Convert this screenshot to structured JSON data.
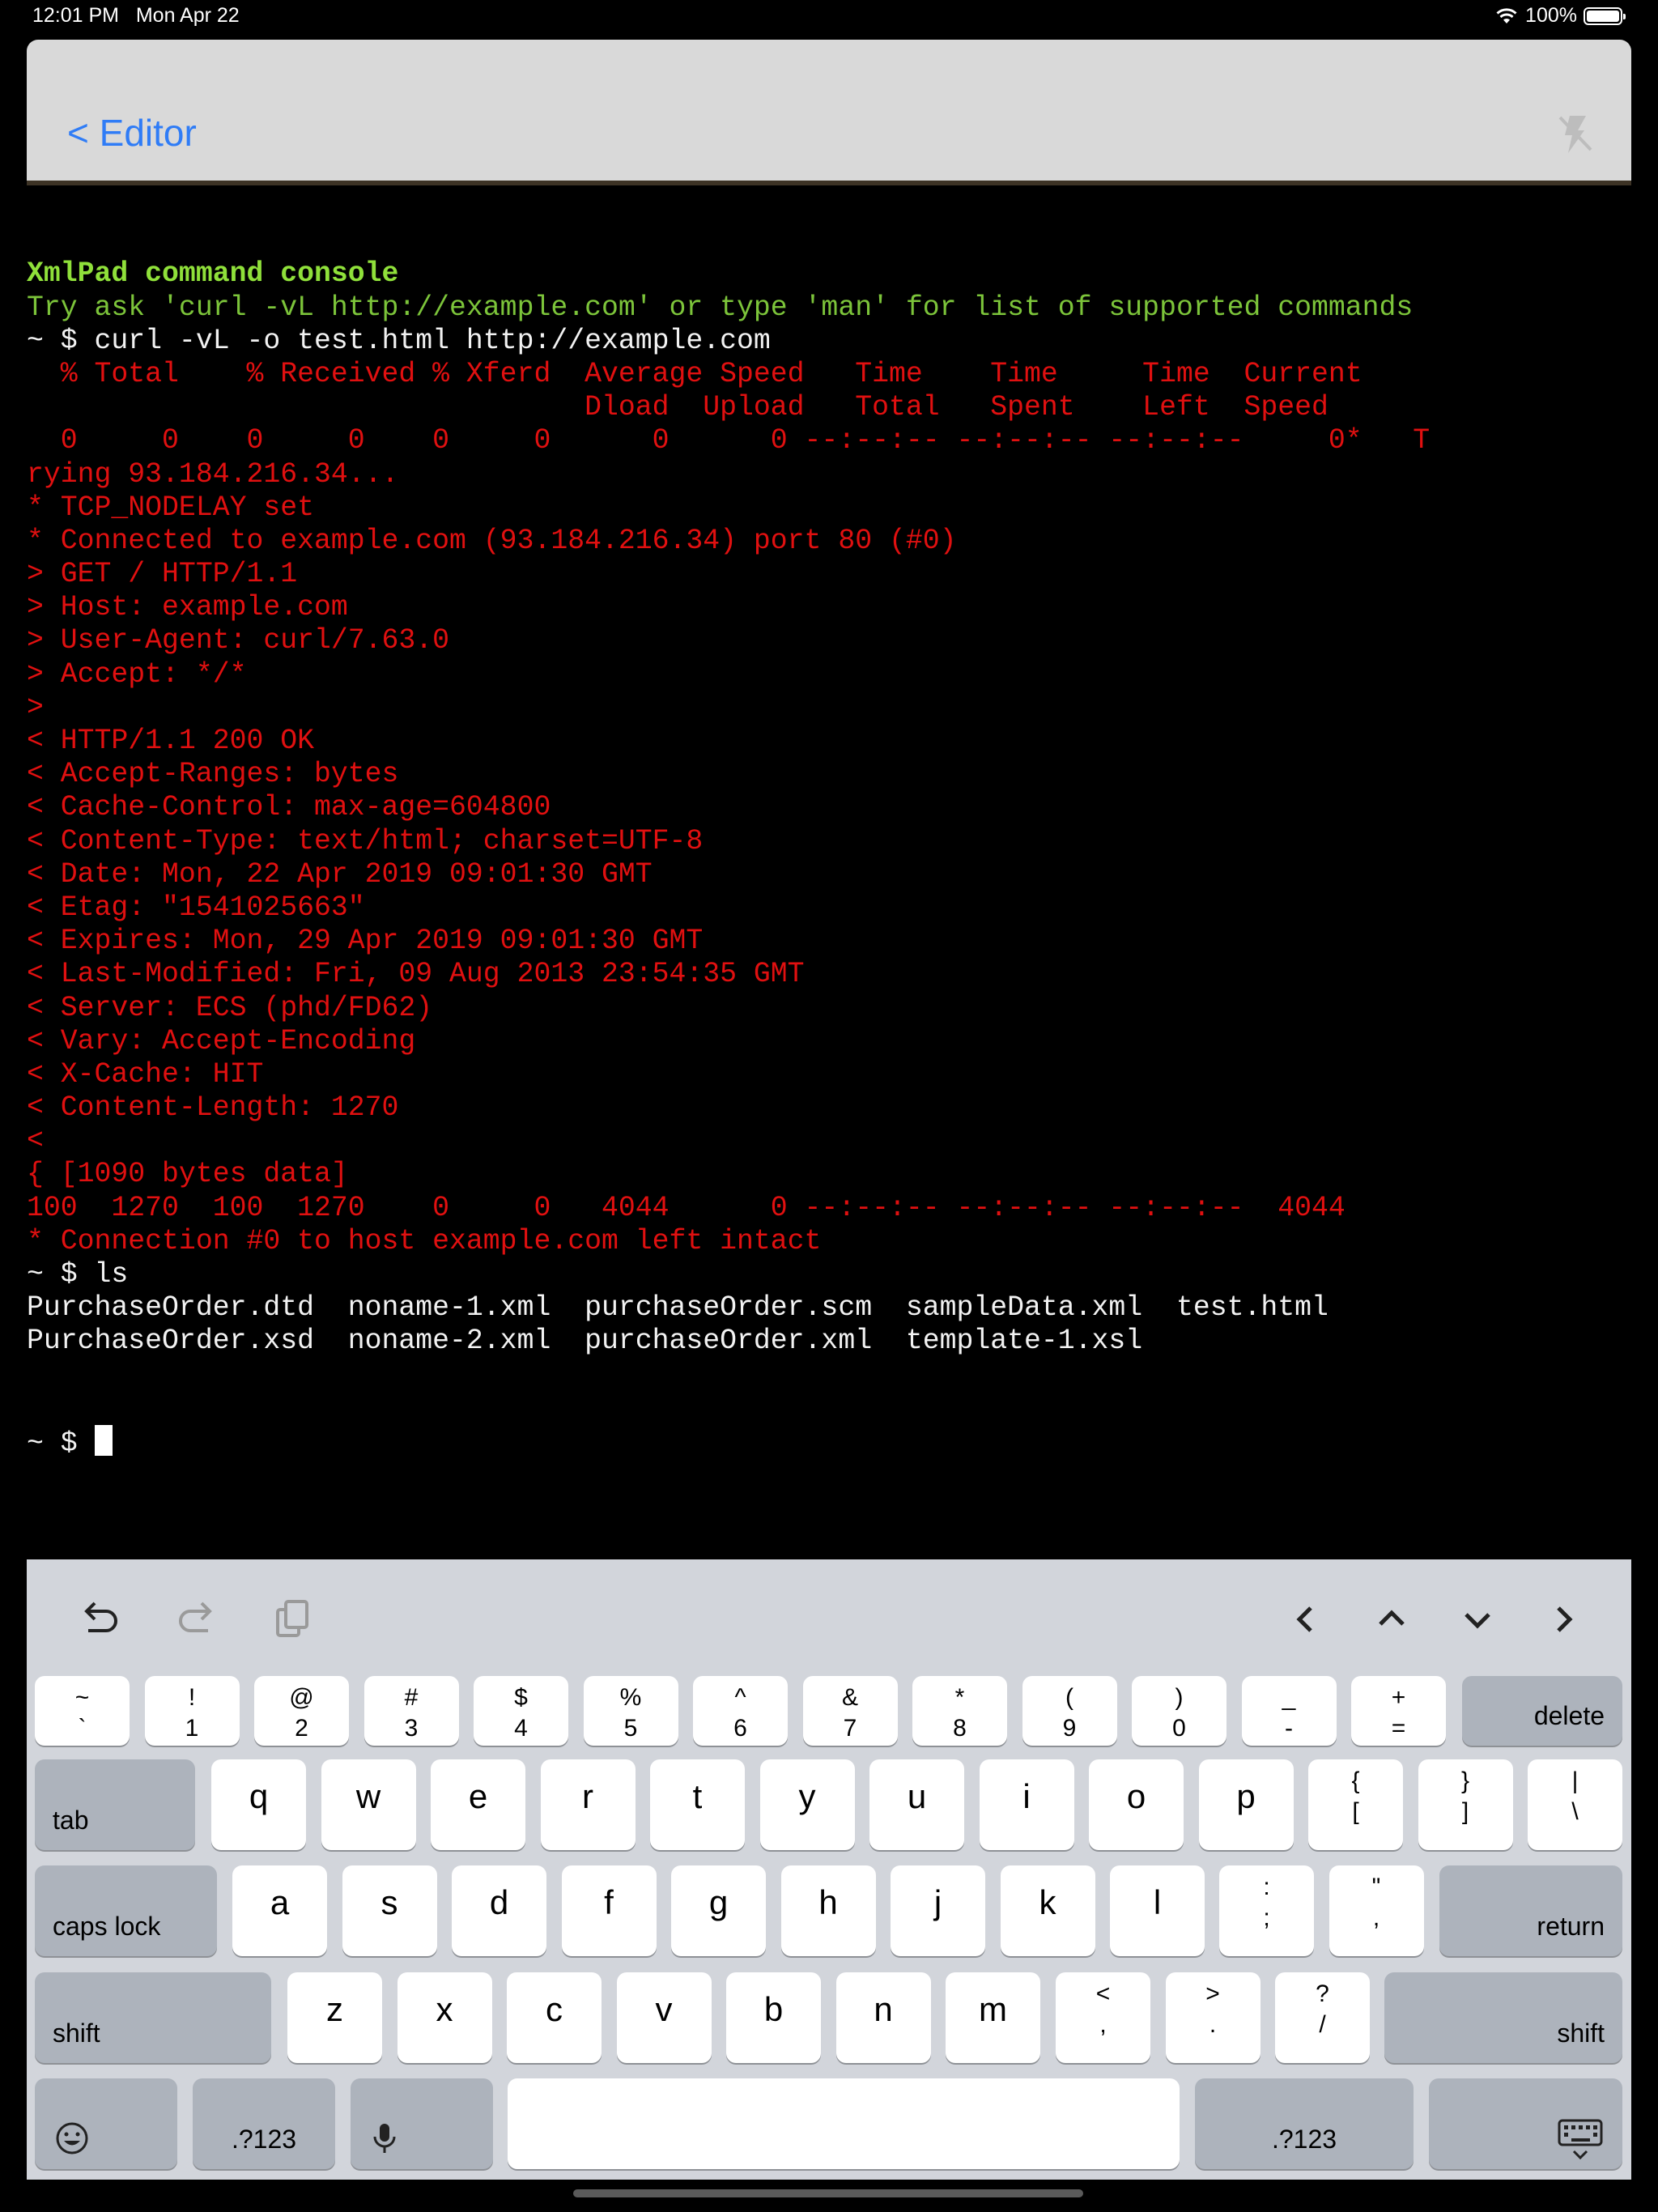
{
  "status_bar": {
    "time": "12:01 PM",
    "date": "Mon Apr 22",
    "battery": "100%",
    "battery_level": 1.0
  },
  "nav": {
    "back_label": "< Editor",
    "flash_icon": "flash-off-icon"
  },
  "terminal": {
    "lines": [
      {
        "text": "XmlPad command console",
        "kind": "title"
      },
      {
        "text": "Try ask 'curl -vL http://example.com' or type 'man' for list of supported commands",
        "kind": "hint"
      },
      {
        "text": "~ $ curl -vL -o test.html http://example.com",
        "kind": "cmd"
      },
      {
        "text": "  % Total    % Received % Xferd  Average Speed   Time    Time     Time  Current",
        "kind": "err"
      },
      {
        "text": "                                 Dload  Upload   Total   Spent    Left  Speed",
        "kind": "err"
      },
      {
        "text": "  0     0    0     0    0     0      0      0 --:--:-- --:--:-- --:--:--     0*   T",
        "kind": "err"
      },
      {
        "text": "rying 93.184.216.34...",
        "kind": "err"
      },
      {
        "text": "* TCP_NODELAY set",
        "kind": "err"
      },
      {
        "text": "* Connected to example.com (93.184.216.34) port 80 (#0)",
        "kind": "err"
      },
      {
        "text": "> GET / HTTP/1.1",
        "kind": "err"
      },
      {
        "text": "> Host: example.com",
        "kind": "err"
      },
      {
        "text": "> User-Agent: curl/7.63.0",
        "kind": "err"
      },
      {
        "text": "> Accept: */*",
        "kind": "err"
      },
      {
        "text": ">",
        "kind": "err"
      },
      {
        "text": "< HTTP/1.1 200 OK",
        "kind": "err"
      },
      {
        "text": "< Accept-Ranges: bytes",
        "kind": "err"
      },
      {
        "text": "< Cache-Control: max-age=604800",
        "kind": "err"
      },
      {
        "text": "< Content-Type: text/html; charset=UTF-8",
        "kind": "err"
      },
      {
        "text": "< Date: Mon, 22 Apr 2019 09:01:30 GMT",
        "kind": "err"
      },
      {
        "text": "< Etag: \"1541025663\"",
        "kind": "err"
      },
      {
        "text": "< Expires: Mon, 29 Apr 2019 09:01:30 GMT",
        "kind": "err"
      },
      {
        "text": "< Last-Modified: Fri, 09 Aug 2013 23:54:35 GMT",
        "kind": "err"
      },
      {
        "text": "< Server: ECS (phd/FD62)",
        "kind": "err"
      },
      {
        "text": "< Vary: Accept-Encoding",
        "kind": "err"
      },
      {
        "text": "< X-Cache: HIT",
        "kind": "err"
      },
      {
        "text": "< Content-Length: 1270",
        "kind": "err"
      },
      {
        "text": "<",
        "kind": "err"
      },
      {
        "text": "{ [1090 bytes data]",
        "kind": "err"
      },
      {
        "text": "100  1270  100  1270    0     0   4044      0 --:--:-- --:--:-- --:--:--  4044",
        "kind": "err"
      },
      {
        "text": "* Connection #0 to host example.com left intact",
        "kind": "err"
      },
      {
        "text": "~ $ ls",
        "kind": "cmd"
      },
      {
        "text": "PurchaseOrder.dtd  noname-1.xml  purchaseOrder.scm  sampleData.xml  test.html",
        "kind": "cmd"
      },
      {
        "text": "PurchaseOrder.xsd  noname-2.xml  purchaseOrder.xml  template-1.xsl",
        "kind": "cmd"
      }
    ],
    "prompt": "~ $ "
  },
  "keyboard": {
    "toolbar_left": [
      "undo-icon",
      "redo-icon",
      "clipboard-icon"
    ],
    "toolbar_right": [
      "arrow-left-icon",
      "arrow-up-icon",
      "arrow-down-icon",
      "arrow-right-icon"
    ],
    "row1": [
      {
        "top": "~",
        "bot": "`"
      },
      {
        "top": "!",
        "bot": "1"
      },
      {
        "top": "@",
        "bot": "2"
      },
      {
        "top": "#",
        "bot": "3"
      },
      {
        "top": "$",
        "bot": "4"
      },
      {
        "top": "%",
        "bot": "5"
      },
      {
        "top": "^",
        "bot": "6"
      },
      {
        "top": "&",
        "bot": "7"
      },
      {
        "top": "*",
        "bot": "8"
      },
      {
        "top": "(",
        "bot": "9"
      },
      {
        "top": ")",
        "bot": "0"
      },
      {
        "top": "_",
        "bot": "-"
      },
      {
        "top": "+",
        "bot": "="
      }
    ],
    "delete_label": "delete",
    "tab_label": "tab",
    "row2": [
      "q",
      "w",
      "e",
      "r",
      "t",
      "y",
      "u",
      "i",
      "o",
      "p"
    ],
    "row2_sym": [
      {
        "top": "{",
        "bot": "["
      },
      {
        "top": "}",
        "bot": "]"
      },
      {
        "top": "|",
        "bot": "\\"
      }
    ],
    "caps_label": "caps lock",
    "row3": [
      "a",
      "s",
      "d",
      "f",
      "g",
      "h",
      "j",
      "k",
      "l"
    ],
    "row3_sym": [
      {
        "top": ":",
        "bot": ";"
      },
      {
        "top": "\"",
        "bot": ","
      }
    ],
    "return_label": "return",
    "shift_label": "shift",
    "row4": [
      "z",
      "x",
      "c",
      "v",
      "b",
      "n",
      "m"
    ],
    "row4_sym": [
      {
        "top": "<",
        "bot": ","
      },
      {
        "top": ">",
        "bot": "."
      },
      {
        "top": "?",
        "bot": "/"
      }
    ],
    "numbers_label": ".?123"
  }
}
